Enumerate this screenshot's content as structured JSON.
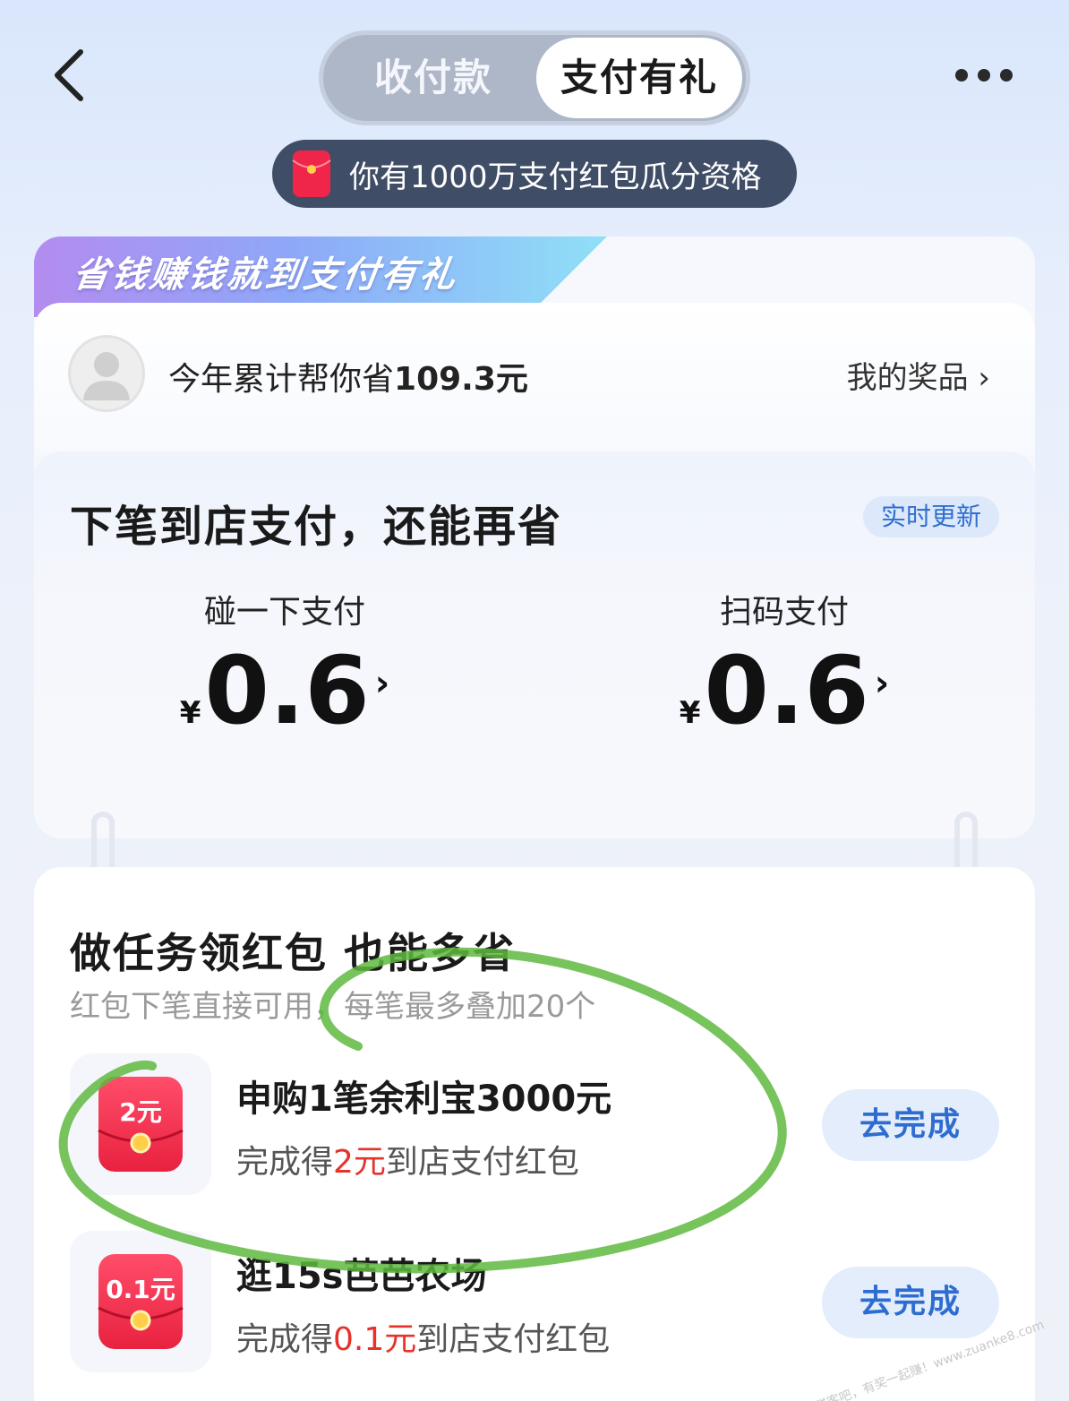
{
  "header": {
    "tabs": [
      {
        "label": "收付款",
        "active": false
      },
      {
        "label": "支付有礼",
        "active": true
      }
    ]
  },
  "banner": {
    "text": "你有1000万支付红包瓜分资格"
  },
  "summary": {
    "slogan": "省钱赚钱就到支付有礼",
    "saved_prefix": "今年累计帮你省",
    "saved_amount": "109.3元",
    "prizes_link": "我的奖品 ›"
  },
  "next_pay": {
    "title": "下笔到店支付，还能再省",
    "badge": "实时更新",
    "methods": [
      {
        "label": "碰一下支付",
        "currency": "¥",
        "amount": "0.6"
      },
      {
        "label": "扫码支付",
        "currency": "¥",
        "amount": "0.6"
      }
    ]
  },
  "tasks_section": {
    "title": "做任务领红包 也能多省",
    "subtitle": "红包下笔直接可用，每笔最多叠加20个",
    "tasks": [
      {
        "icon_amount": "2元",
        "title": "申购1笔余利宝3000元",
        "desc_prefix": "完成得",
        "desc_amount": "2元",
        "desc_suffix": "到店支付红包",
        "button": "去完成"
      },
      {
        "icon_amount": "0.1元",
        "title": "逛15s芭芭农场",
        "desc_prefix": "完成得",
        "desc_amount": "0.1元",
        "desc_suffix": "到店支付红包",
        "button": "去完成"
      }
    ]
  },
  "colors": {
    "accent_blue": "#2e6cd0",
    "highlight_red": "#e5332a",
    "banner_bg": "#3f4d66",
    "annotation_green": "#5fb83f"
  },
  "watermark": "赚客吧，有奖一起赚！www.zuanke8.com"
}
